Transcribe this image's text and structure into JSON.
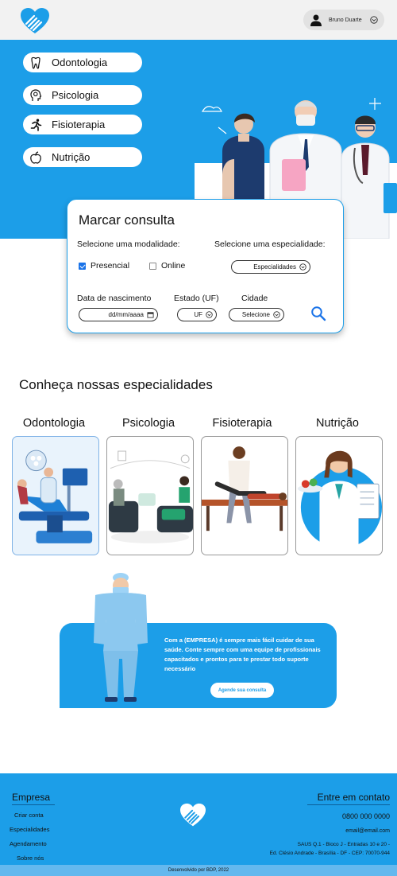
{
  "header": {
    "logo_icon": "heart-hand-logo-icon",
    "user": {
      "name": "Bruno Duarte",
      "icon": "user-icon",
      "arrow_icon": "chevron-circle-icon"
    }
  },
  "hero": {
    "specialties": [
      {
        "label": "Odontologia",
        "icon": "tooth-icon"
      },
      {
        "label": "Psicologia",
        "icon": "head-brain-icon"
      },
      {
        "label": "Fisioterapia",
        "icon": "running-person-icon"
      },
      {
        "label": "Nutrição",
        "icon": "apple-icon"
      }
    ]
  },
  "booking": {
    "title": "Marcar consulta",
    "modality_label": "Selecione uma modalidade:",
    "specialty_label": "Selecione uma especialidade:",
    "presencial": {
      "label": "Presencial",
      "checked": true
    },
    "online": {
      "label": "Online",
      "checked": false
    },
    "specialty_select": "Especialidades",
    "birth_label": "Data de nascimento",
    "birth_placeholder": "dd/mm/aaaa",
    "state_label": "Estado (UF)",
    "state_select": "UF",
    "city_label": "Cidade",
    "city_select": "Selecione"
  },
  "specialties_section": {
    "title": "Conheça nossas especialidades",
    "items": [
      {
        "name": "Odontologia"
      },
      {
        "name": "Psicologia"
      },
      {
        "name": "Fisioterapia"
      },
      {
        "name": "Nutrição"
      }
    ]
  },
  "promo": {
    "text": "Com a (EMPRESA) é sempre mais fácil cuidar de sua saúde. Conte sempre com uma equipe de profissionais capacitados e prontos para te prestar todo suporte necessário",
    "button": "Agende sua consulta"
  },
  "footer": {
    "left_title": "Empresa",
    "links": [
      "Criar conta",
      "Especialidades",
      "Agendamento",
      "Sobre nós"
    ],
    "right_title": "Entre em contato",
    "phone": "0800 000 0000",
    "email": "email@email.com",
    "address_1": "SAUS Q.1 - Bloco J - Entradas 10 e 20 -",
    "address_2": "Ed. Clésio Andrade - Brasília - DF - CEP: 70070-944",
    "copyright": "Desenvolvido por BDP, 2022"
  },
  "colors": {
    "primary": "#1c9ee8",
    "header_bg": "#f2f2f2",
    "footer_bar": "#64b8ee"
  }
}
